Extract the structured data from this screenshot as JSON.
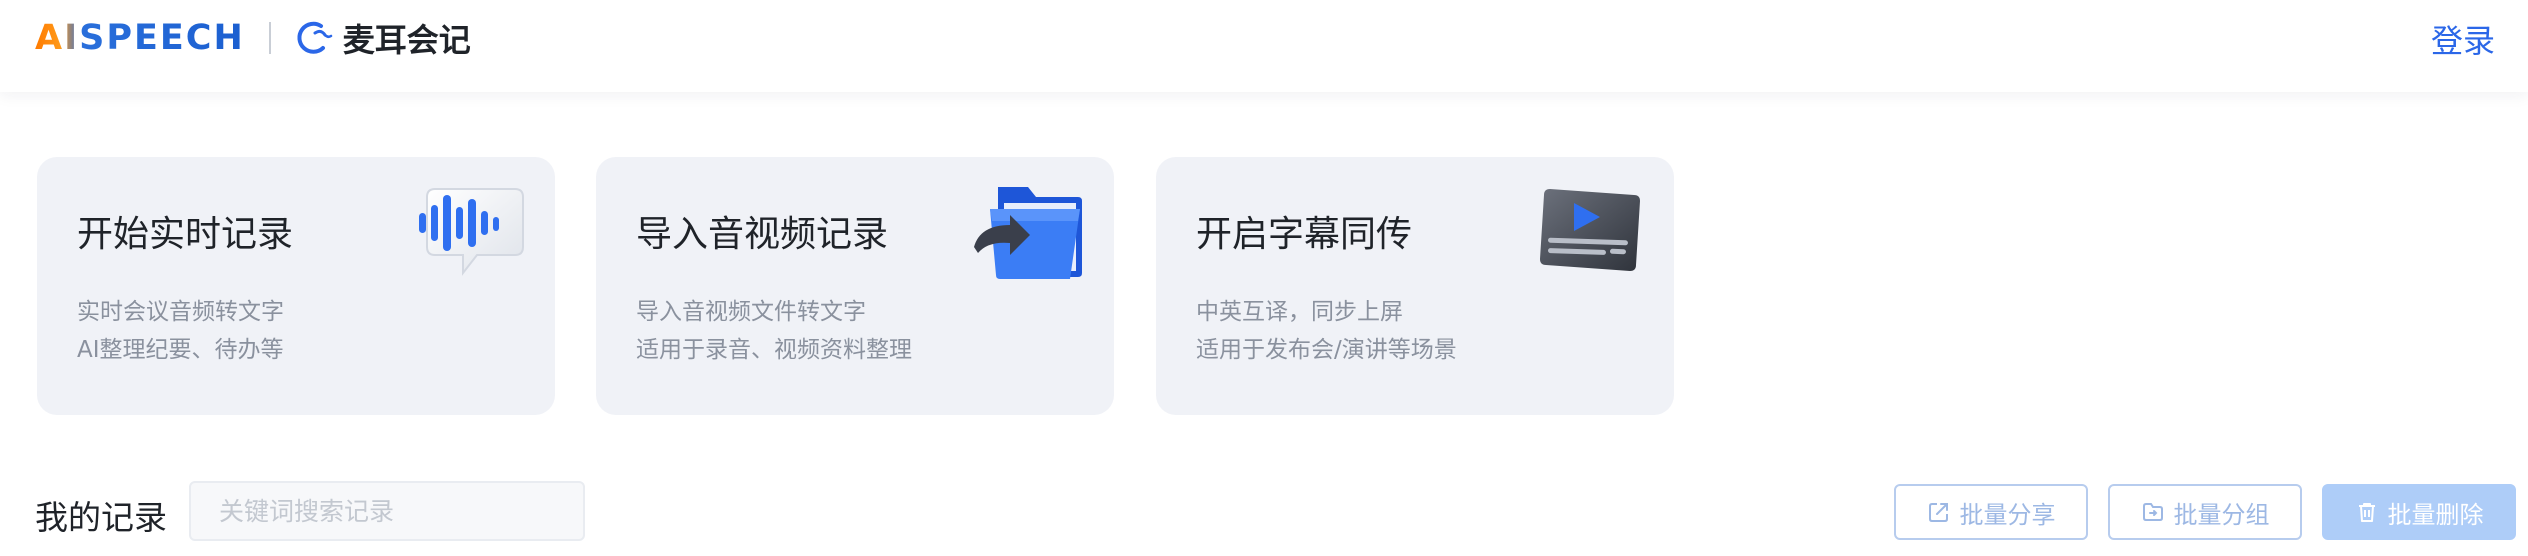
{
  "header": {
    "brand": "AISPEECH",
    "app_name": "麦耳会记",
    "login_label": "登录"
  },
  "cards": [
    {
      "title": "开始实时记录",
      "desc_line1": "实时会议音频转文字",
      "desc_line2": "AI整理纪要、待办等",
      "icon": "voice-wave-bubble-icon"
    },
    {
      "title": "导入音视频记录",
      "desc_line1": "导入音视频文件转文字",
      "desc_line2": "适用于录音、视频资料整理",
      "icon": "import-folder-icon"
    },
    {
      "title": "开启字幕同传",
      "desc_line1": "中英互译，同步上屏",
      "desc_line2": "适用于发布会/演讲等场景",
      "icon": "subtitle-screen-icon"
    }
  ],
  "records": {
    "title": "我的记录",
    "search_placeholder": "关键词搜索记录",
    "share_label": "批量分享",
    "group_label": "批量分组",
    "delete_label": "批量删除"
  },
  "colors": {
    "accent": "#2b67e8",
    "card_bg": "#f0f2f7",
    "brand_orange": "#ff7a00",
    "disabled_button": "#aecdf8"
  }
}
